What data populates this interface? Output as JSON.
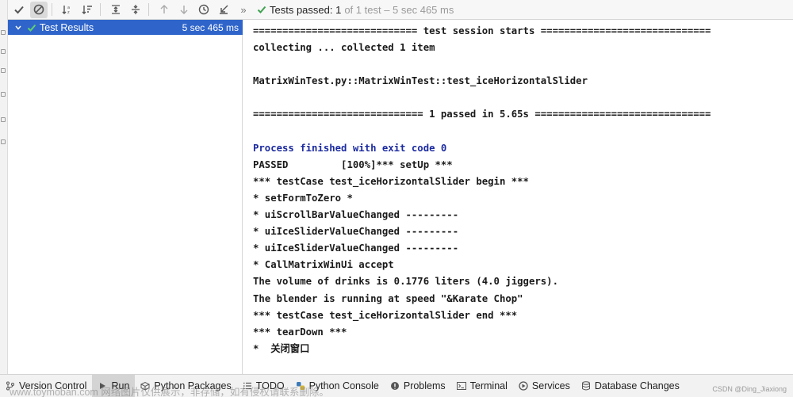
{
  "toolbar": {
    "status_main": "Tests passed: 1",
    "status_sub": "of 1 test – 5 sec 465 ms",
    "more": "»"
  },
  "tree": {
    "root_label": "Test Results",
    "root_time": "5 sec 465 ms"
  },
  "console": {
    "lines": [
      {
        "text": "============================ test session starts =============================",
        "style": "normal"
      },
      {
        "text": "collecting ... collected 1 item",
        "style": "normal"
      },
      {
        "text": "",
        "style": "normal"
      },
      {
        "text": "MatrixWinTest.py::MatrixWinTest::test_iceHorizontalSlider",
        "style": "normal"
      },
      {
        "text": "",
        "style": "normal"
      },
      {
        "text": "============================= 1 passed in 5.65s ==============================",
        "style": "normal"
      },
      {
        "text": "",
        "style": "normal"
      },
      {
        "text": "Process finished with exit code 0",
        "style": "blue"
      },
      {
        "text": "PASSED         [100%]*** setUp ***",
        "style": "normal"
      },
      {
        "text": "*** testCase test_iceHorizontalSlider begin ***",
        "style": "normal"
      },
      {
        "text": "* setFormToZero *",
        "style": "normal"
      },
      {
        "text": "* uiScrollBarValueChanged ---------",
        "style": "normal"
      },
      {
        "text": "* uiIceSliderValueChanged ---------",
        "style": "normal"
      },
      {
        "text": "* uiIceSliderValueChanged ---------",
        "style": "normal"
      },
      {
        "text": "* CallMatrixWinUi accept",
        "style": "normal"
      },
      {
        "text": "The volume of drinks is 0.1776 liters (4.0 jiggers).",
        "style": "normal"
      },
      {
        "text": "The blender is running at speed \"&Karate Chop\"",
        "style": "normal"
      },
      {
        "text": "*** testCase test_iceHorizontalSlider end ***",
        "style": "normal"
      },
      {
        "text": "*** tearDown ***",
        "style": "normal"
      },
      {
        "text": "*  关闭窗口",
        "style": "normal"
      }
    ]
  },
  "bottom_bar": {
    "items": [
      {
        "label": "Version Control",
        "icon": "git-branch-icon"
      },
      {
        "label": "Run",
        "icon": "run-icon"
      },
      {
        "label": "Python Packages",
        "icon": "packages-icon"
      },
      {
        "label": "TODO",
        "icon": "todo-icon"
      },
      {
        "label": "Python Console",
        "icon": "python-console-icon"
      },
      {
        "label": "Problems",
        "icon": "problems-icon"
      },
      {
        "label": "Terminal",
        "icon": "terminal-icon"
      },
      {
        "label": "Services",
        "icon": "services-icon"
      },
      {
        "label": "Database Changes",
        "icon": "database-changes-icon"
      }
    ]
  },
  "watermark": {
    "left": "www.toymoban.com 网络图片仅供展示，非存储，如有侵权请联系删除。",
    "right": "CSDN @Ding_Jiaxiong"
  },
  "colors": {
    "selection": "#2f65ca",
    "pass_green": "#3ea14f",
    "console_blue": "#1c2ba0"
  }
}
